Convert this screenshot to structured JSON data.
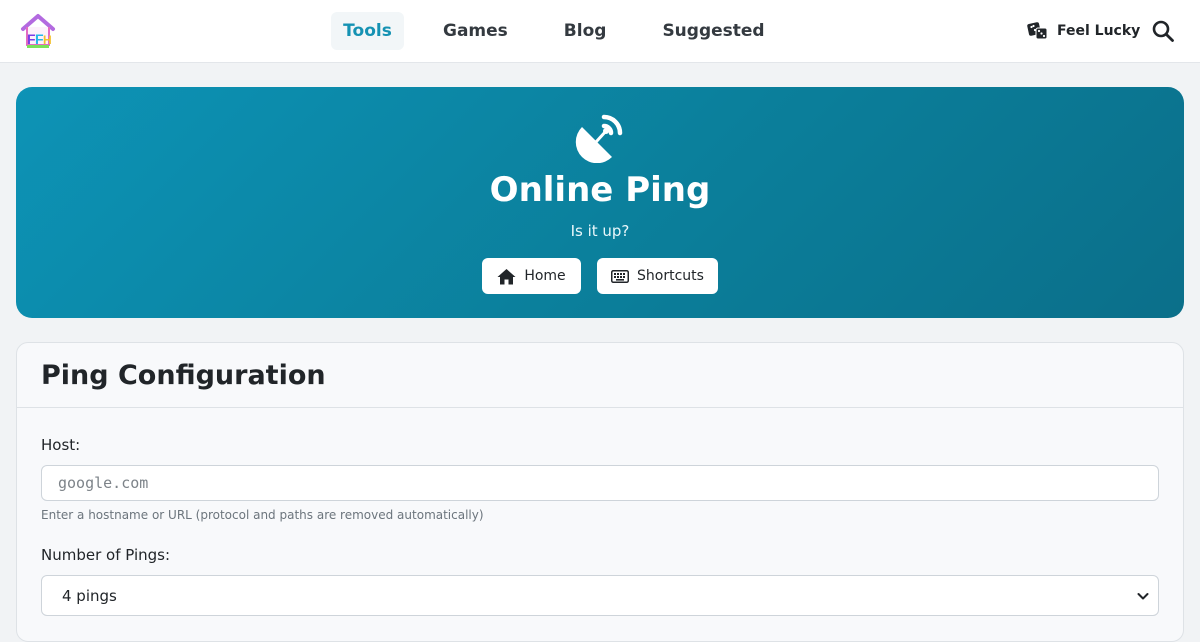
{
  "navbar": {
    "logo_text": "FFH",
    "links": [
      {
        "label": "Tools",
        "active": true
      },
      {
        "label": "Games",
        "active": false
      },
      {
        "label": "Blog",
        "active": false
      },
      {
        "label": "Suggested",
        "active": false
      }
    ],
    "lucky_label": "Feel Lucky",
    "lucky_icon": "dice-icon",
    "search_icon": "search-icon"
  },
  "hero": {
    "icon": "satellite-dish-icon",
    "title": "Online Ping",
    "subtitle": "Is it up?",
    "buttons": [
      {
        "label": "Home",
        "icon": "home-icon"
      },
      {
        "label": "Shortcuts",
        "icon": "keyboard-icon"
      }
    ]
  },
  "config": {
    "title": "Ping Configuration",
    "host_label": "Host:",
    "host_placeholder": "google.com",
    "host_value": "",
    "host_help": "Enter a hostname or URL (protocol and paths are removed automatically)",
    "pings_label": "Number of Pings:",
    "pings_selected": "4 pings"
  },
  "colors": {
    "accent": "#1592b3",
    "hero_gradient_start": "#0d93b6",
    "hero_gradient_end": "#0b6f8a",
    "page_background": "#f1f3f5"
  }
}
